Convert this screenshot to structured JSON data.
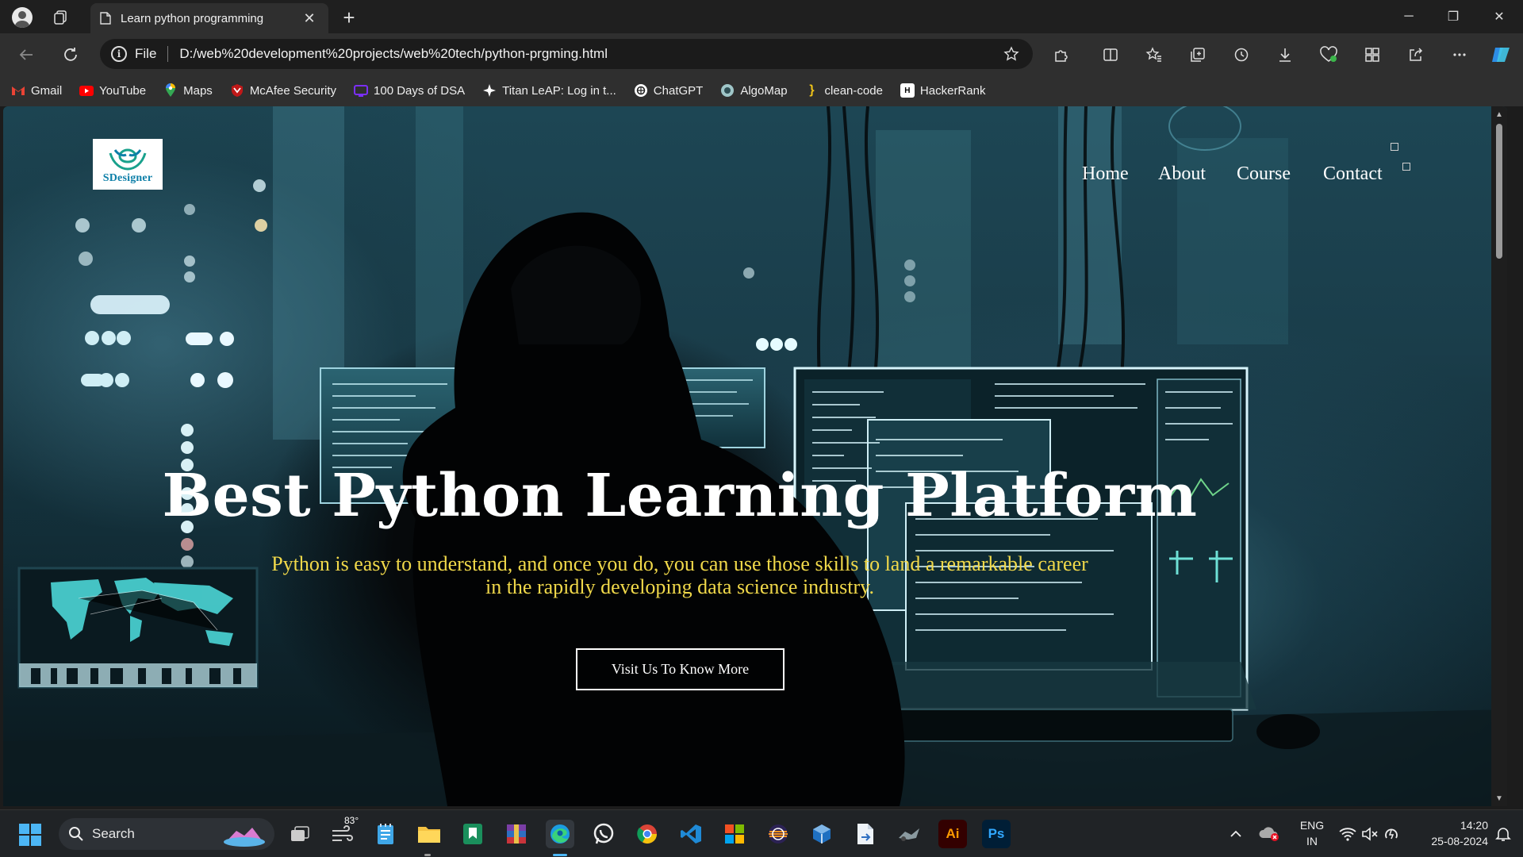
{
  "browser": {
    "tab_title": "Learn python programming",
    "tab_close": "✕",
    "new_tab": "+",
    "window_controls": {
      "minimize": "─",
      "restore": "❐",
      "close": "✕"
    },
    "address": {
      "scheme_label": "File",
      "url": "D:/web%20development%20projects/web%20tech/python-prgming.html"
    },
    "bookmarks": [
      {
        "label": "Gmail",
        "icon": "gmail-icon",
        "color": "#ea4335"
      },
      {
        "label": "YouTube",
        "icon": "youtube-icon",
        "color": "#ff0000"
      },
      {
        "label": "Maps",
        "icon": "maps-pin-icon",
        "color": "#34a853"
      },
      {
        "label": "McAfee Security",
        "icon": "mcafee-shield-icon",
        "color": "#c01818"
      },
      {
        "label": "100 Days of DSA",
        "icon": "dsa-icon",
        "color": "#7b2ff7"
      },
      {
        "label": "Titan LeAP: Log in t...",
        "icon": "titan-star-icon",
        "color": "#ffffff"
      },
      {
        "label": "ChatGPT",
        "icon": "chatgpt-icon",
        "color": "#ffffff"
      },
      {
        "label": "AlgoMap",
        "icon": "algomap-icon",
        "color": "#9fc6c8"
      },
      {
        "label": "clean-code",
        "icon": "clean-code-icon",
        "color": "#f0c419"
      },
      {
        "label": "HackerRank",
        "icon": "hackerrank-icon",
        "color": "#ffffff"
      }
    ]
  },
  "site": {
    "logo_text": "SDesigner",
    "nav": [
      "Home",
      "About",
      "Course",
      "Contact"
    ],
    "hero_title": "Best Python Learning Platform",
    "hero_subtitle_line1": "Python is easy to understand, and once you do, you can use those skills to land a remarkable career",
    "hero_subtitle_line2": "in the rapidly developing data science industry.",
    "cta_label": "Visit Us To Know More"
  },
  "taskbar": {
    "search_label": "Search",
    "weather_temp": "83°",
    "language": "ENG",
    "region": "IN",
    "time": "14:20",
    "date": "25-08-2024",
    "apps": [
      "task-view",
      "weather",
      "notepad",
      "file-explorer",
      "bookmark-app",
      "winrar",
      "edge",
      "whatsapp",
      "chrome",
      "vscode",
      "microsoft-store",
      "eclipse",
      "virtualbox",
      "file-transfer",
      "game-app",
      "illustrator",
      "photoshop"
    ],
    "illustrator_label": "Ai",
    "photoshop_label": "Ps"
  },
  "colors": {
    "accent": "#4cb6f5",
    "hero_subtitle": "#f1d94a",
    "logo_text": "#0d7fa8"
  }
}
